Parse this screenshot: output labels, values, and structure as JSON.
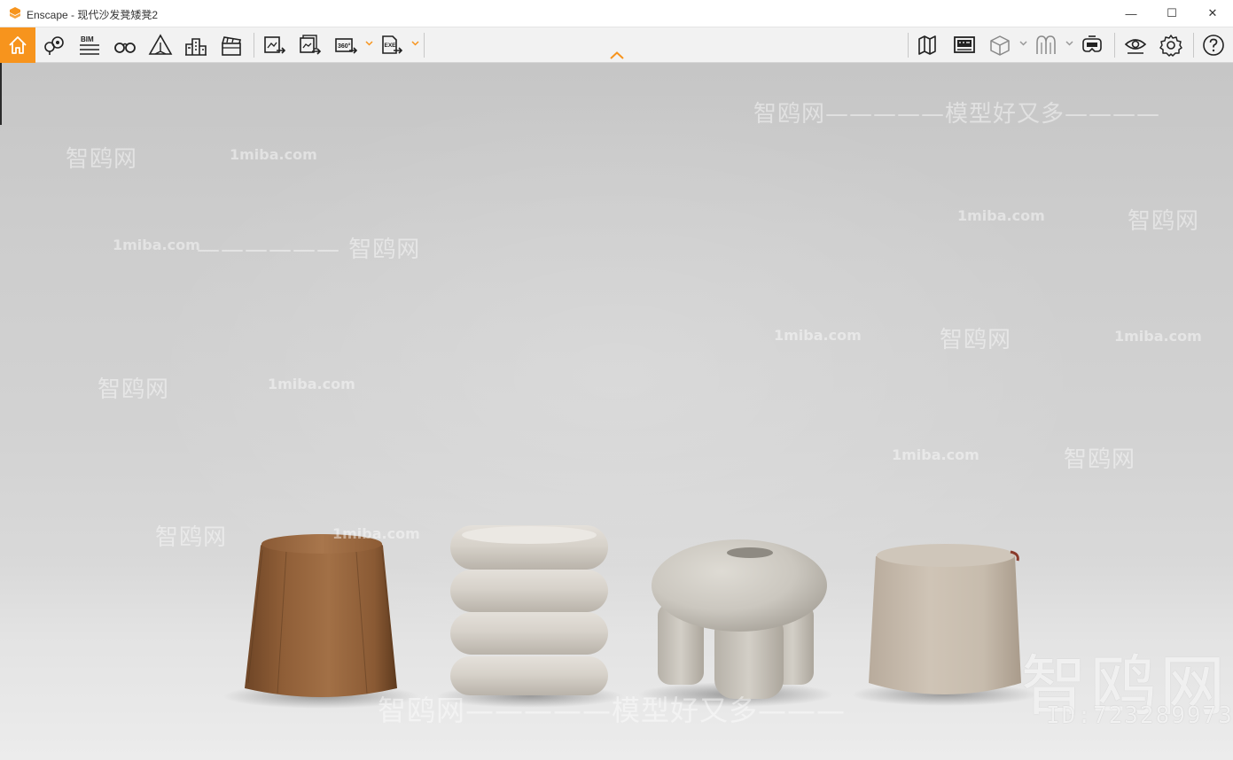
{
  "window": {
    "title": "Enscape - 现代沙发凳矮凳2",
    "minimize_glyph": "—",
    "maximize_glyph": "☐",
    "close_glyph": "✕"
  },
  "toolbar": {
    "accent_color": "#f7941d",
    "bim_label": "BIM",
    "pano_label": "360°",
    "exe_label": "EXE",
    "left_icons": [
      "home-icon",
      "location-icon",
      "bim-icon",
      "binoculars-icon",
      "perspective-icon",
      "buildings-icon",
      "clapper-icon",
      "screenshot-export-icon",
      "batch-render-icon",
      "panorama-360-icon",
      "exe-export-icon"
    ],
    "right_icons": [
      "map-icon",
      "asset-library-icon",
      "view-cube-icon",
      "material-editor-icon",
      "vr-headset-icon",
      "visual-settings-icon",
      "settings-icon",
      "help-icon"
    ]
  },
  "watermarks": {
    "site": "1miba.com",
    "brand": "智鸥网",
    "slogan": "智鸥网—————模型好又多———",
    "line1": "智鸥网—————模型好又多————",
    "line2": "智鸥网",
    "brand_dashed": "—————— 智鸥网",
    "logo": "智鸥网",
    "id": "ID:723289973"
  }
}
